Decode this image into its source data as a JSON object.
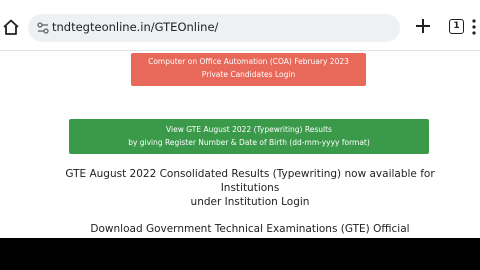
{
  "browser": {
    "url": "tndtegteonline.in/GTEOnline/",
    "tab_count": "1",
    "icons": [
      "home-icon",
      "site-info-icon",
      "new-tab-icon",
      "tab-switcher-icon",
      "menu-icon"
    ]
  },
  "page": {
    "coa_banner": {
      "line1": "Computer on Office Automation (COA) February 2023",
      "line2": "Private Candidates Login",
      "color": "#e8685a"
    },
    "gte_banner": {
      "line1": "View GTE August 2022 (Typewriting) Results",
      "line2": "by giving Register Number & Date of Birth (dd-mm-yyyy format)",
      "color": "#3a9a4a"
    },
    "consolidated": {
      "line1": "GTE August 2022 Consolidated Results (Typewriting) now available for",
      "line2": "Institutions",
      "line3": "under Institution Login"
    },
    "download_text": "Download Government Technical Examinations (GTE) Official"
  }
}
